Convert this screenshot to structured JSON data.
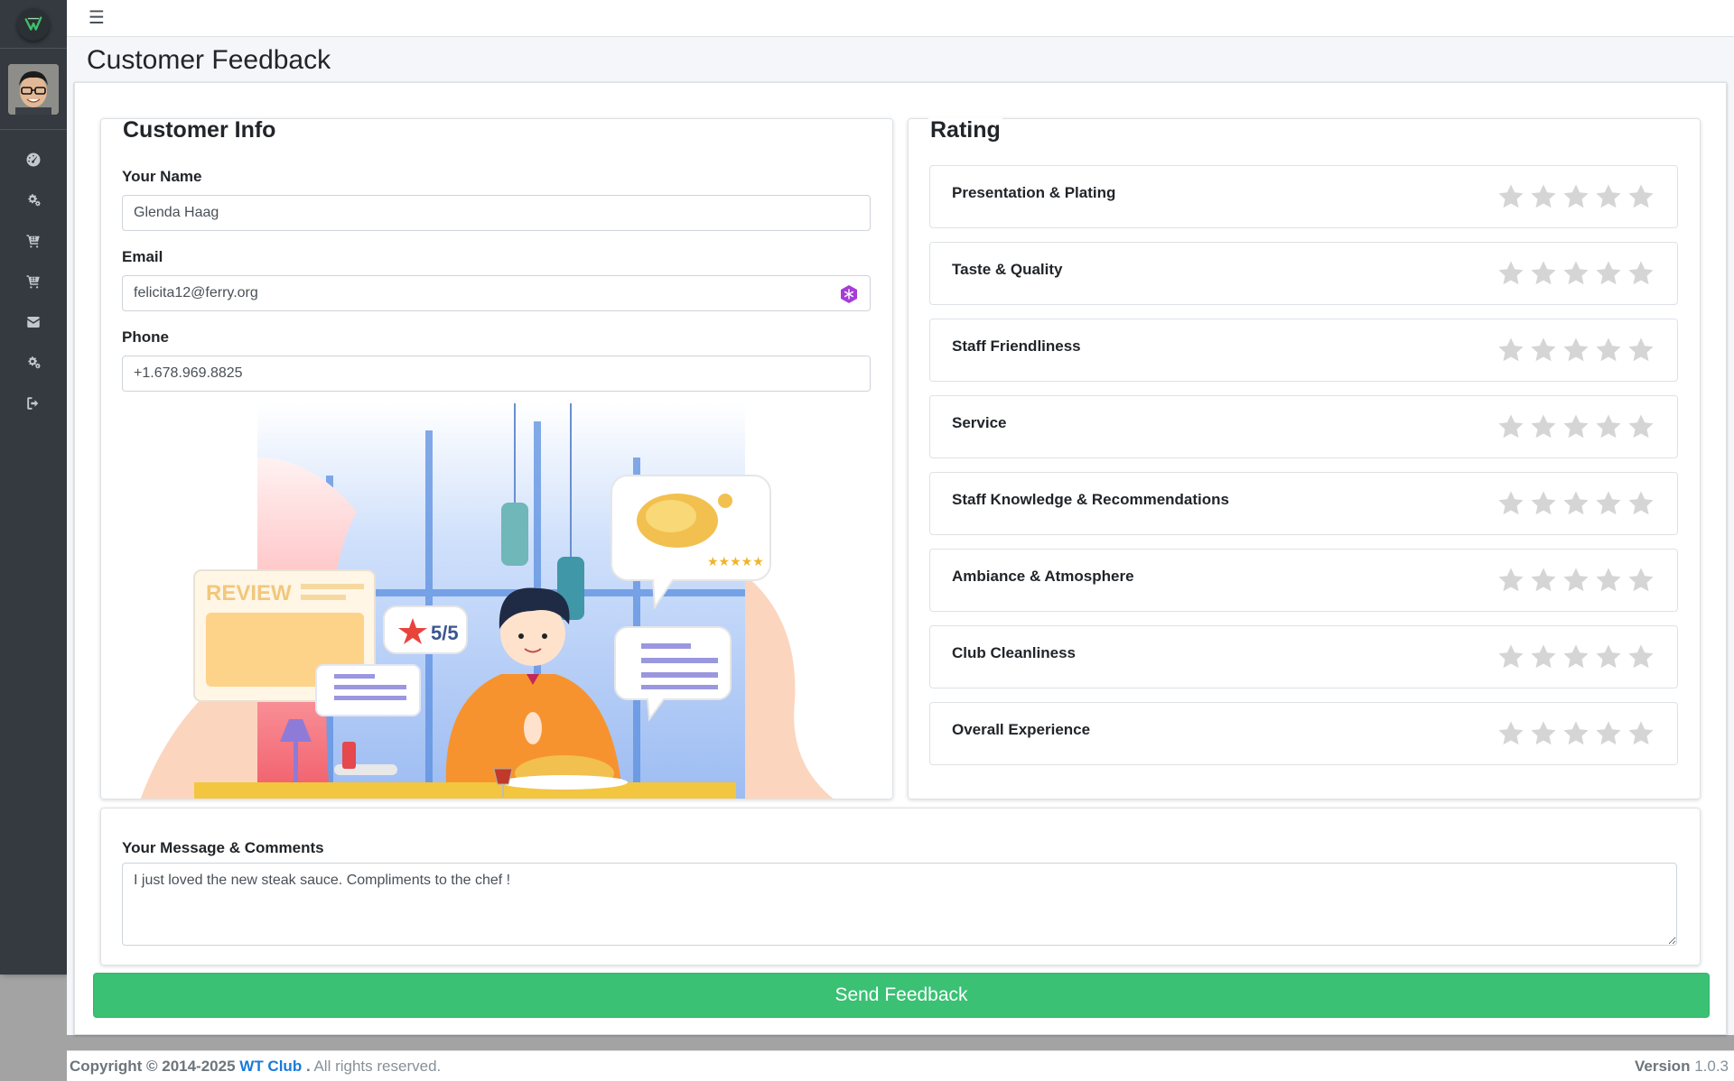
{
  "page": {
    "title": "Customer Feedback"
  },
  "sidebar": {
    "icons": [
      "dashboard-icon",
      "settings-icon",
      "cart-icon",
      "cart-icon",
      "mail-icon",
      "settings-icon",
      "sign-out-icon"
    ]
  },
  "customer_info": {
    "legend": "Customer Info",
    "name_label": "Your Name",
    "name_value": "Glenda Haag",
    "email_label": "Email",
    "email_value": "felicita12@ferry.org",
    "phone_label": "Phone",
    "phone_value": "+1.678.969.8825"
  },
  "illustration": {
    "review_word": "REVIEW",
    "score": "5/5"
  },
  "rating": {
    "legend": "Rating",
    "items": [
      {
        "label": "Presentation & Plating",
        "stars": 0
      },
      {
        "label": "Taste & Quality",
        "stars": 0
      },
      {
        "label": "Staff Friendliness",
        "stars": 0
      },
      {
        "label": "Service",
        "stars": 0
      },
      {
        "label": "Staff Knowledge & Recommendations",
        "stars": 0
      },
      {
        "label": "Ambiance & Atmosphere",
        "stars": 0
      },
      {
        "label": "Club Cleanliness",
        "stars": 0
      },
      {
        "label": "Overall Experience",
        "stars": 0
      }
    ],
    "max_stars": 5
  },
  "message": {
    "label": "Your Message & Comments",
    "value": "I just loved the new steak sauce. Compliments to the chef !"
  },
  "send_button": "Send Feedback",
  "footer": {
    "copyright_prefix": "Copyright © 2014-2025",
    "brand": "WT Club",
    "dot": ".",
    "rights": "All rights reserved.",
    "version_label": "Version",
    "version_value": "1.0.3"
  },
  "colors": {
    "sidebar": "#343a40",
    "accent_green": "#3ac174",
    "link_blue": "#1a7ad9",
    "star_empty": "#d5d5d5"
  }
}
